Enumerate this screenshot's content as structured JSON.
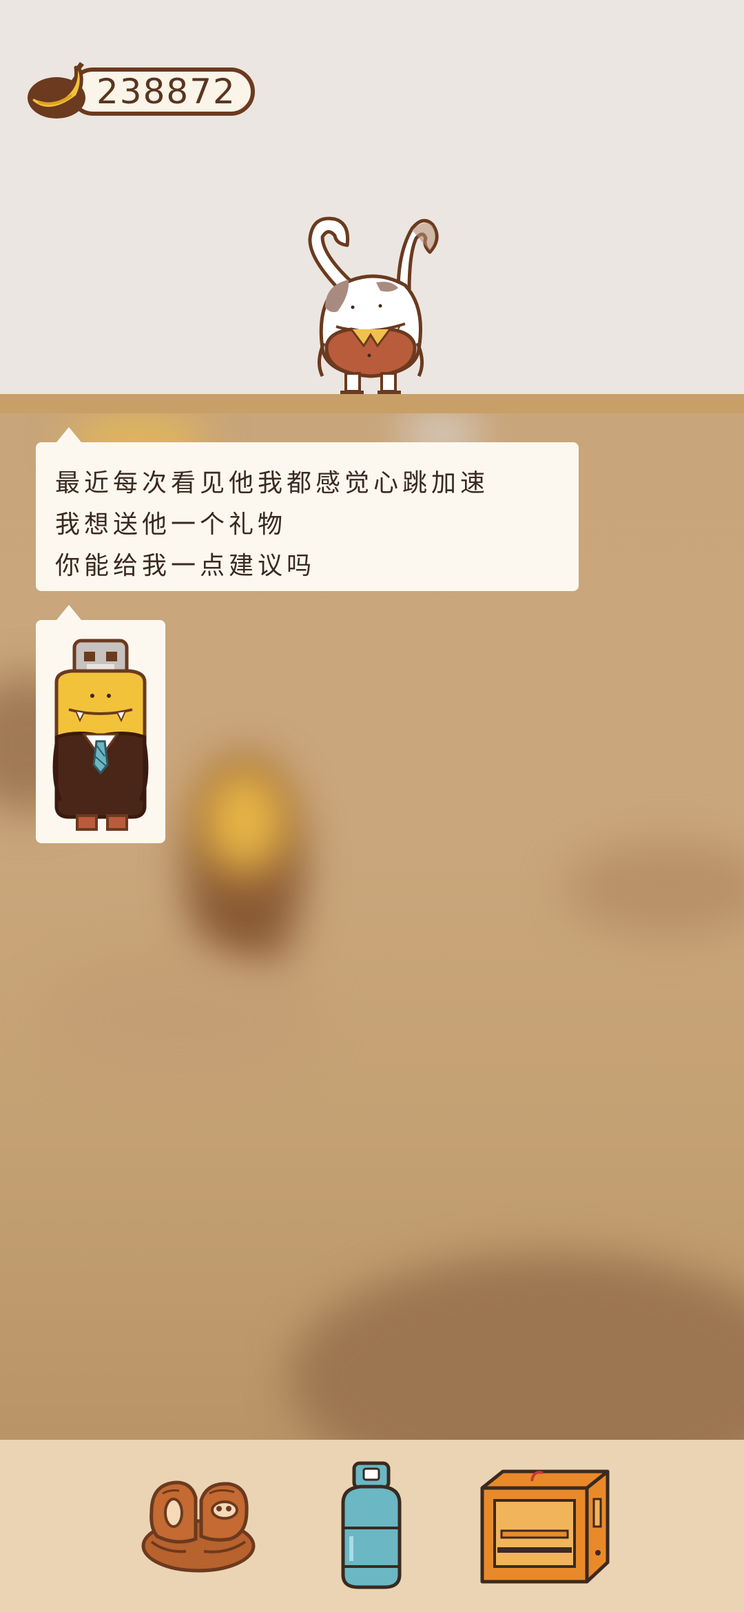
{
  "currency": {
    "value": "238872",
    "icon": "banana-icon"
  },
  "dialog": {
    "lines": [
      "最近每次看见他我都感觉心跳加速",
      "我想送他一个礼物",
      "你能给我一点建议吗"
    ]
  },
  "toolbar": {
    "items": [
      {
        "icon": "rope-coil-icon"
      },
      {
        "icon": "gas-tank-icon"
      },
      {
        "icon": "3d-printer-icon"
      }
    ]
  },
  "colors": {
    "wall": "#ebe6e1",
    "shelf": "#c99f68",
    "floor": "#c8a57a",
    "toolbar": "#ebd4b4",
    "bubble": "#fcf8ef",
    "outline": "#6b3a1f"
  }
}
